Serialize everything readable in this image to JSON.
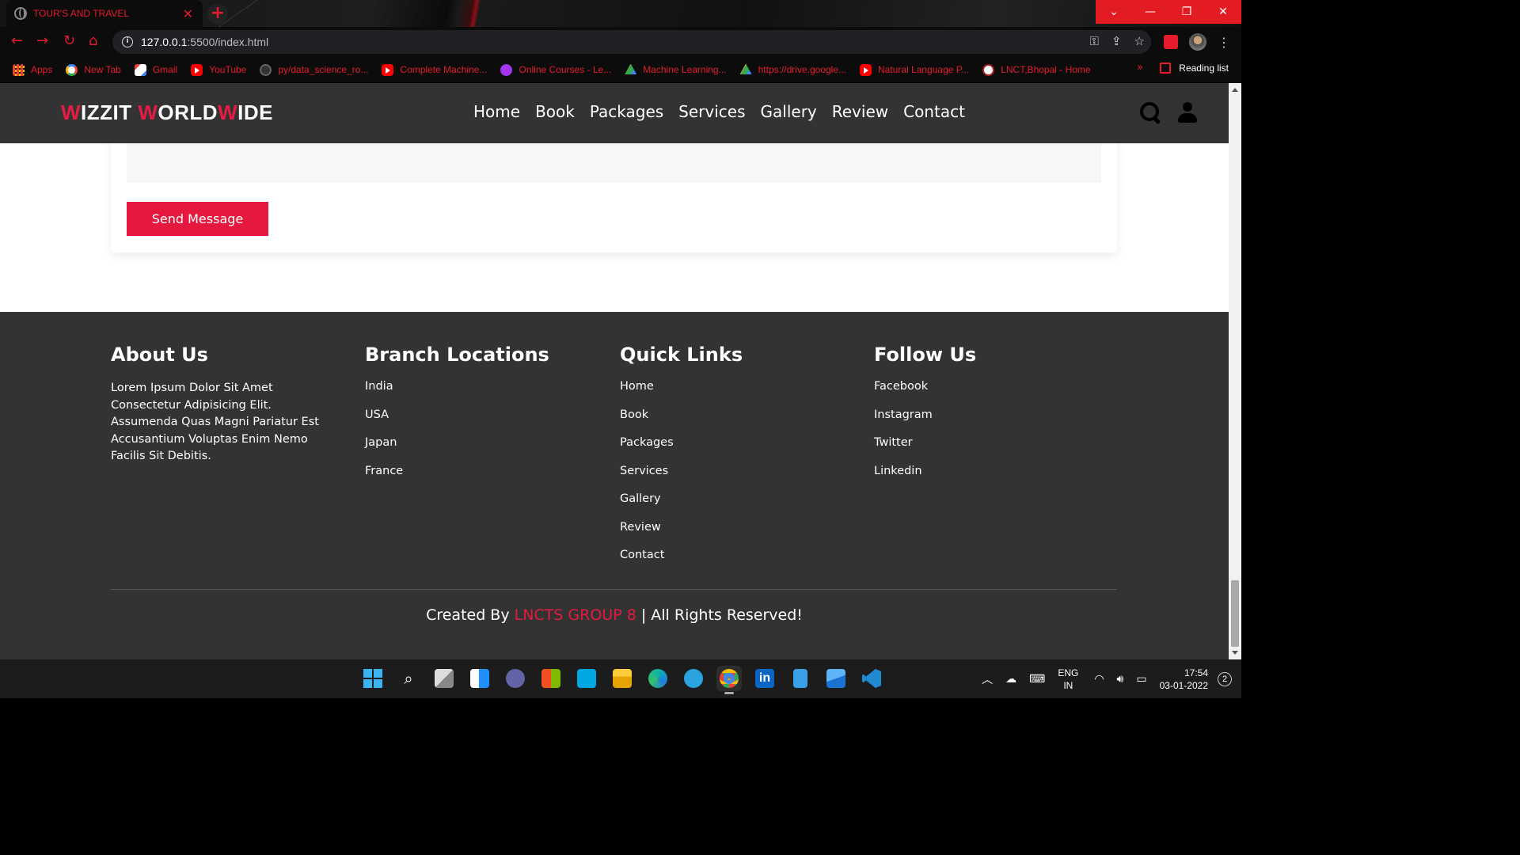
{
  "browser": {
    "tab_title": "TOUR'S AND TRAVEL",
    "tab_close": "✕",
    "new_tab": "+",
    "url_host": "127.0.0.1",
    "url_path": ":5500/index.html",
    "bookmarks": [
      {
        "label": "Apps",
        "icon": "apps-grid-icon"
      },
      {
        "label": "New Tab",
        "icon": "google-icon"
      },
      {
        "label": "Gmail",
        "icon": "gmail-icon"
      },
      {
        "label": "YouTube",
        "icon": "youtube-icon"
      },
      {
        "label": "py/data_science_ro...",
        "icon": "github-icon"
      },
      {
        "label": "Complete Machine...",
        "icon": "youtube-icon"
      },
      {
        "label": "Online Courses - Le...",
        "icon": "udemy-icon"
      },
      {
        "label": "Machine Learning...",
        "icon": "google-drive-icon"
      },
      {
        "label": "https://drive.google...",
        "icon": "google-drive-icon"
      },
      {
        "label": "Natural Language P...",
        "icon": "youtube-icon"
      },
      {
        "label": "LNCT,Bhopal - Home",
        "icon": "lnct-icon"
      }
    ],
    "reading_list": "Reading list",
    "accent_color": "#e51c2d"
  },
  "site": {
    "logo": {
      "w1": "W",
      "rest1": "IZZIT ",
      "w2": "W",
      "rest2": "ORLD",
      "w3": "W",
      "rest3": "IDE"
    },
    "nav": [
      "Home",
      "Book",
      "Packages",
      "Services",
      "Gallery",
      "Review",
      "Contact"
    ],
    "send_button": "Send Message",
    "footer": {
      "about": {
        "title": "About Us",
        "text": "Lorem Ipsum Dolor Sit Amet Consectetur Adipisicing Elit. Assumenda Quas Magni Pariatur Est Accusantium Voluptas Enim Nemo Facilis Sit Debitis."
      },
      "branches": {
        "title": "Branch Locations",
        "items": [
          "India",
          "USA",
          "Japan",
          "France"
        ]
      },
      "quick_links": {
        "title": "Quick Links",
        "items": [
          "Home",
          "Book",
          "Packages",
          "Services",
          "Gallery",
          "Review",
          "Contact"
        ]
      },
      "follow": {
        "title": "Follow Us",
        "items": [
          "Facebook",
          "Instagram",
          "Twitter",
          "Linkedin"
        ]
      },
      "credit_prefix": "Created By ",
      "credit_highlight": "LNCTS GROUP 8",
      "credit_suffix": " | All Rights Reserved!"
    },
    "brand_color": "#e5193f",
    "header_bg": "#333333"
  },
  "taskbar": {
    "lang_top": "ENG",
    "lang_bottom": "IN",
    "time": "17:54",
    "date": "03-01-2022",
    "notifications": "2"
  }
}
